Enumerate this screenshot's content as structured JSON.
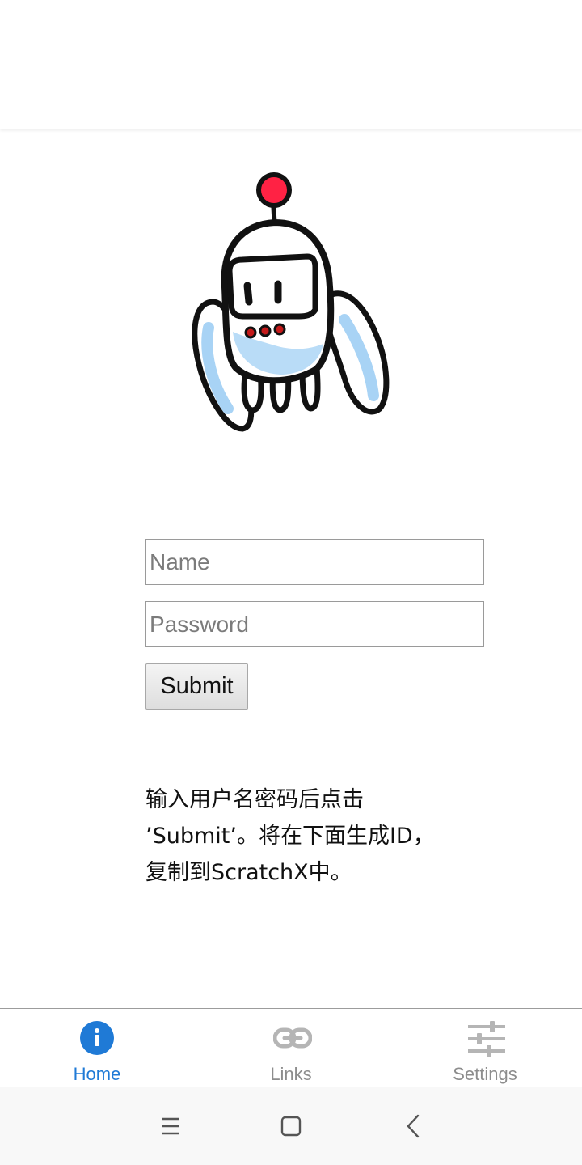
{
  "login_form": {
    "name_placeholder": "Name",
    "name_value": "",
    "password_placeholder": "Password",
    "password_value": "",
    "submit_label": "Submit"
  },
  "instructions": {
    "line1": "输入用户名密码后点击",
    "line2": "’Submit’。将在下面生成ID，",
    "line3": "复制到ScratchX中。"
  },
  "bottom_nav": {
    "active_color": "#1f7ad6",
    "inactive_color": "#8d8d8d",
    "tabs": [
      {
        "label": "Home",
        "icon": "info-icon",
        "active": true
      },
      {
        "label": "Links",
        "icon": "link-icon",
        "active": false
      },
      {
        "label": "Settings",
        "icon": "sliders-icon",
        "active": false
      }
    ]
  },
  "system_nav": {
    "buttons": [
      "menu-icon",
      "home-square-icon",
      "back-chevron-icon"
    ]
  },
  "mascot": {
    "icon": "robot-mascot-icon"
  }
}
